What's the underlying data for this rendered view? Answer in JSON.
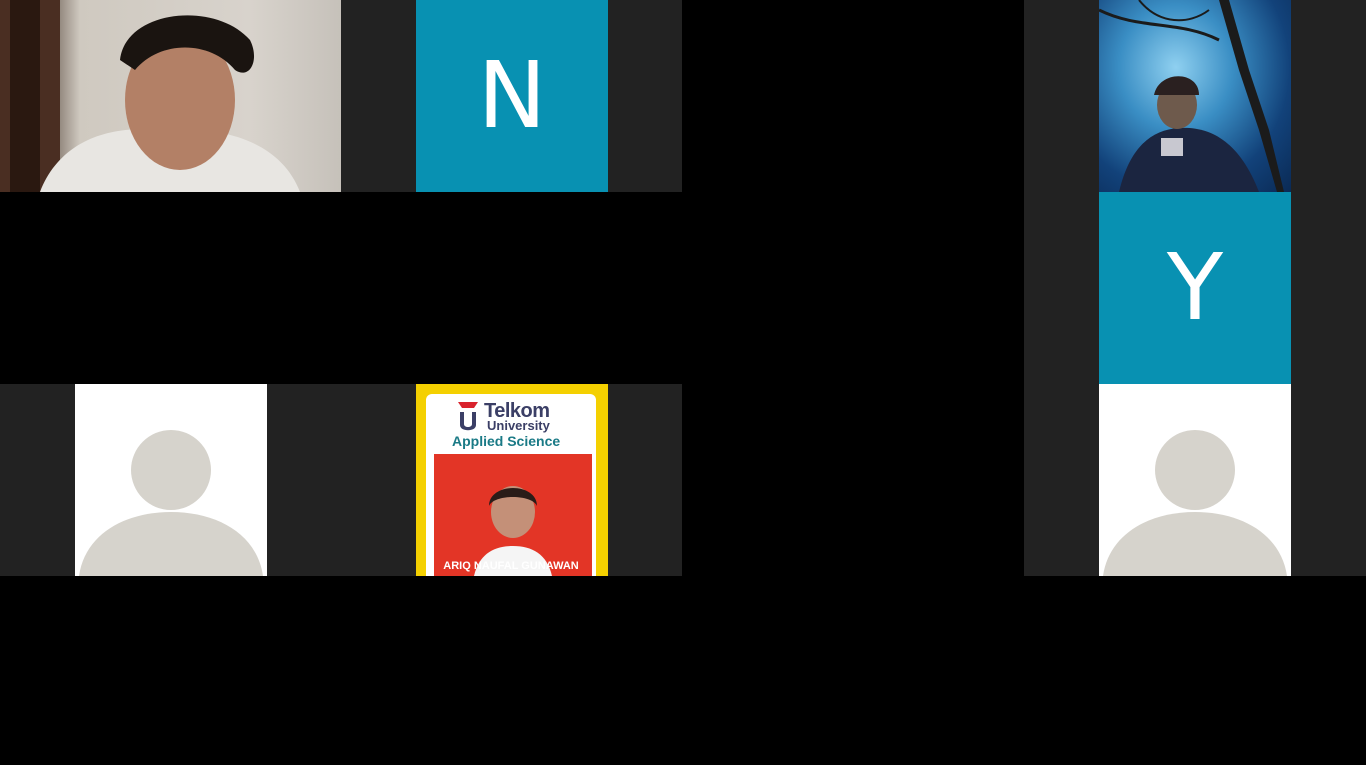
{
  "participants": [
    {
      "type": "camera",
      "description_name": "participant-1"
    },
    {
      "type": "initial",
      "initial": "N"
    },
    {
      "type": "camera",
      "description_name": "participant-3"
    },
    {
      "type": "initial",
      "initial": "Y"
    },
    {
      "type": "avatar"
    },
    {
      "type": "camera-idcard",
      "card": {
        "brand": "Telkom",
        "brand_sub": "University",
        "dept": "Applied Science",
        "name": "ARIQ NAUFAL GUNAWAN"
      }
    },
    {
      "type": "avatar"
    }
  ],
  "colors": {
    "initial_bg": "#0891b2",
    "tile_bg": "#222222",
    "avatar_fg": "#d6d3cc"
  }
}
